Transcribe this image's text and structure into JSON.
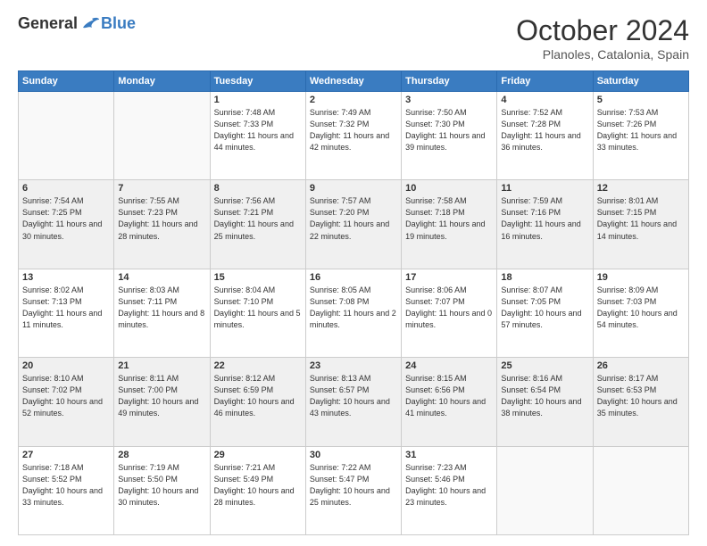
{
  "logo": {
    "general": "General",
    "blue": "Blue"
  },
  "title": "October 2024",
  "subtitle": "Planoles, Catalonia, Spain",
  "days_of_week": [
    "Sunday",
    "Monday",
    "Tuesday",
    "Wednesday",
    "Thursday",
    "Friday",
    "Saturday"
  ],
  "weeks": [
    [
      {
        "day": "",
        "info": ""
      },
      {
        "day": "",
        "info": ""
      },
      {
        "day": "1",
        "info": "Sunrise: 7:48 AM\nSunset: 7:33 PM\nDaylight: 11 hours and 44 minutes."
      },
      {
        "day": "2",
        "info": "Sunrise: 7:49 AM\nSunset: 7:32 PM\nDaylight: 11 hours and 42 minutes."
      },
      {
        "day": "3",
        "info": "Sunrise: 7:50 AM\nSunset: 7:30 PM\nDaylight: 11 hours and 39 minutes."
      },
      {
        "day": "4",
        "info": "Sunrise: 7:52 AM\nSunset: 7:28 PM\nDaylight: 11 hours and 36 minutes."
      },
      {
        "day": "5",
        "info": "Sunrise: 7:53 AM\nSunset: 7:26 PM\nDaylight: 11 hours and 33 minutes."
      }
    ],
    [
      {
        "day": "6",
        "info": "Sunrise: 7:54 AM\nSunset: 7:25 PM\nDaylight: 11 hours and 30 minutes."
      },
      {
        "day": "7",
        "info": "Sunrise: 7:55 AM\nSunset: 7:23 PM\nDaylight: 11 hours and 28 minutes."
      },
      {
        "day": "8",
        "info": "Sunrise: 7:56 AM\nSunset: 7:21 PM\nDaylight: 11 hours and 25 minutes."
      },
      {
        "day": "9",
        "info": "Sunrise: 7:57 AM\nSunset: 7:20 PM\nDaylight: 11 hours and 22 minutes."
      },
      {
        "day": "10",
        "info": "Sunrise: 7:58 AM\nSunset: 7:18 PM\nDaylight: 11 hours and 19 minutes."
      },
      {
        "day": "11",
        "info": "Sunrise: 7:59 AM\nSunset: 7:16 PM\nDaylight: 11 hours and 16 minutes."
      },
      {
        "day": "12",
        "info": "Sunrise: 8:01 AM\nSunset: 7:15 PM\nDaylight: 11 hours and 14 minutes."
      }
    ],
    [
      {
        "day": "13",
        "info": "Sunrise: 8:02 AM\nSunset: 7:13 PM\nDaylight: 11 hours and 11 minutes."
      },
      {
        "day": "14",
        "info": "Sunrise: 8:03 AM\nSunset: 7:11 PM\nDaylight: 11 hours and 8 minutes."
      },
      {
        "day": "15",
        "info": "Sunrise: 8:04 AM\nSunset: 7:10 PM\nDaylight: 11 hours and 5 minutes."
      },
      {
        "day": "16",
        "info": "Sunrise: 8:05 AM\nSunset: 7:08 PM\nDaylight: 11 hours and 2 minutes."
      },
      {
        "day": "17",
        "info": "Sunrise: 8:06 AM\nSunset: 7:07 PM\nDaylight: 11 hours and 0 minutes."
      },
      {
        "day": "18",
        "info": "Sunrise: 8:07 AM\nSunset: 7:05 PM\nDaylight: 10 hours and 57 minutes."
      },
      {
        "day": "19",
        "info": "Sunrise: 8:09 AM\nSunset: 7:03 PM\nDaylight: 10 hours and 54 minutes."
      }
    ],
    [
      {
        "day": "20",
        "info": "Sunrise: 8:10 AM\nSunset: 7:02 PM\nDaylight: 10 hours and 52 minutes."
      },
      {
        "day": "21",
        "info": "Sunrise: 8:11 AM\nSunset: 7:00 PM\nDaylight: 10 hours and 49 minutes."
      },
      {
        "day": "22",
        "info": "Sunrise: 8:12 AM\nSunset: 6:59 PM\nDaylight: 10 hours and 46 minutes."
      },
      {
        "day": "23",
        "info": "Sunrise: 8:13 AM\nSunset: 6:57 PM\nDaylight: 10 hours and 43 minutes."
      },
      {
        "day": "24",
        "info": "Sunrise: 8:15 AM\nSunset: 6:56 PM\nDaylight: 10 hours and 41 minutes."
      },
      {
        "day": "25",
        "info": "Sunrise: 8:16 AM\nSunset: 6:54 PM\nDaylight: 10 hours and 38 minutes."
      },
      {
        "day": "26",
        "info": "Sunrise: 8:17 AM\nSunset: 6:53 PM\nDaylight: 10 hours and 35 minutes."
      }
    ],
    [
      {
        "day": "27",
        "info": "Sunrise: 7:18 AM\nSunset: 5:52 PM\nDaylight: 10 hours and 33 minutes."
      },
      {
        "day": "28",
        "info": "Sunrise: 7:19 AM\nSunset: 5:50 PM\nDaylight: 10 hours and 30 minutes."
      },
      {
        "day": "29",
        "info": "Sunrise: 7:21 AM\nSunset: 5:49 PM\nDaylight: 10 hours and 28 minutes."
      },
      {
        "day": "30",
        "info": "Sunrise: 7:22 AM\nSunset: 5:47 PM\nDaylight: 10 hours and 25 minutes."
      },
      {
        "day": "31",
        "info": "Sunrise: 7:23 AM\nSunset: 5:46 PM\nDaylight: 10 hours and 23 minutes."
      },
      {
        "day": "",
        "info": ""
      },
      {
        "day": "",
        "info": ""
      }
    ]
  ]
}
